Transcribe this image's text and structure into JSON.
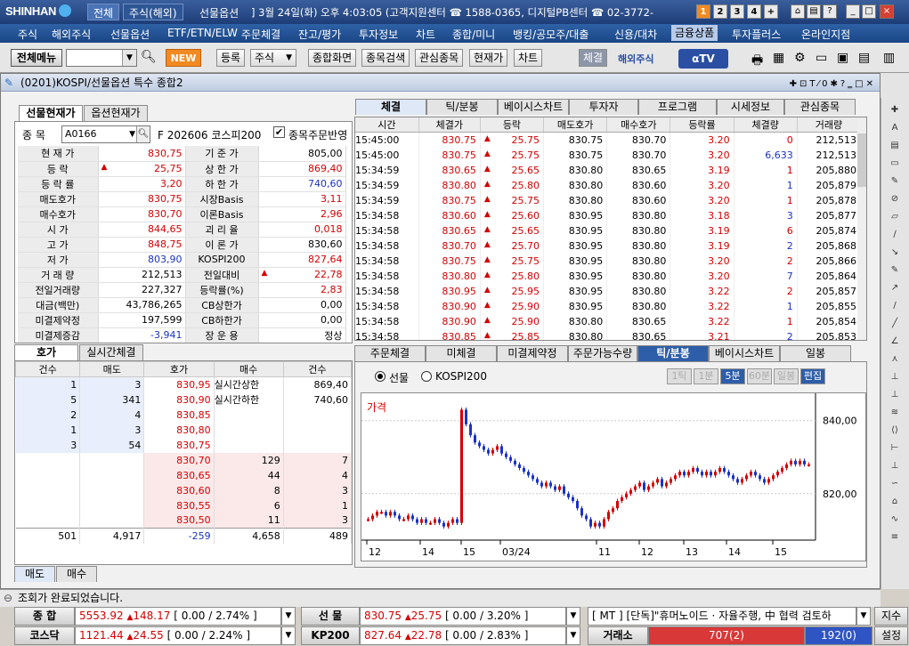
{
  "titlebar": {
    "logo": "SHINHAN",
    "tabs": [
      "전체",
      "주식(해외)",
      "선물옵션"
    ],
    "info": "] 3월 24일(화) 오후 4:03:05 (고객지원센터 ☎ 1588-0365, 디지털PB센터 ☎ 02-3772-",
    "nums": [
      "1",
      "2",
      "3",
      "4",
      "+"
    ]
  },
  "menubar": {
    "items": [
      "주식",
      "해외주식",
      "선물옵션",
      "ETF/ETN/ELW",
      "주문체결",
      "잔고/평가",
      "투자정보",
      "차트",
      "종합/미니",
      "뱅킹/공모주/대출",
      "신용/대차",
      "금융상품",
      "투자플러스",
      "온라인지점"
    ]
  },
  "toolbar": {
    "menu_label": "전체메뉴",
    "new_label": "NEW",
    "buttons": [
      "등록",
      "주식",
      "종합화면",
      "종목검색",
      "관심종목",
      "현재가",
      "차트"
    ],
    "settle_label": "체결",
    "overseas_label": "해외주식",
    "tv_label": "TV"
  },
  "window": {
    "title": "(0201)KOSPI/선물옵션 특수 종합2"
  },
  "left": {
    "tabs": [
      "선물현재가",
      "옵션현재가"
    ],
    "code_label": "종 목",
    "code_value": "A0166",
    "product": "F 202606 코스피200",
    "order_check": "종목주문반영"
  },
  "quote": {
    "rows": [
      {
        "l": "현 재 가",
        "v": "830,75",
        "vc": "red",
        "tri": false,
        "l2": "기 준 가",
        "v2": "805,00",
        "v2c": ""
      },
      {
        "l": "등 락",
        "v": "25,75",
        "vc": "red",
        "tri": true,
        "l2": "상 한 가",
        "v2": "869,40",
        "v2c": "red"
      },
      {
        "l": "등 락 률",
        "v": "3,20",
        "vc": "red",
        "tri": false,
        "l2": "하 한 가",
        "v2": "740,60",
        "v2c": "blue"
      },
      {
        "l": "매도호가",
        "v": "830,75",
        "vc": "red",
        "tri": false,
        "l2": "시장Basis",
        "v2": "3,11",
        "v2c": "red"
      },
      {
        "l": "매수호가",
        "v": "830,70",
        "vc": "red",
        "tri": false,
        "l2": "이론Basis",
        "v2": "2,96",
        "v2c": "red"
      },
      {
        "l": "시 가",
        "v": "844,65",
        "vc": "red",
        "tri": false,
        "l2": "괴 리 율",
        "v2": "0,018",
        "v2c": "red"
      },
      {
        "l": "고 가",
        "v": "848,75",
        "vc": "red",
        "tri": false,
        "l2": "이 론 가",
        "v2": "830,60",
        "v2c": ""
      },
      {
        "l": "저 가",
        "v": "803,90",
        "vc": "blue",
        "tri": false,
        "l2": "KOSPI200",
        "v2": "827,64",
        "v2c": "red"
      },
      {
        "l": "거 래 량",
        "v": "212,513",
        "vc": "",
        "tri": false,
        "l2": "전일대비",
        "v2": "22,78",
        "v2c": "red",
        "tri2": true
      },
      {
        "l": "전일거래량",
        "v": "227,327",
        "vc": "",
        "tri": false,
        "l2": "등락률(%)",
        "v2": "2,83",
        "v2c": "red"
      },
      {
        "l": "대금(백만)",
        "v": "43,786,265",
        "vc": "",
        "tri": false,
        "l2": "CB상한가",
        "v2": "0,00",
        "v2c": ""
      },
      {
        "l": "미결제약정",
        "v": "197,599",
        "vc": "",
        "tri": false,
        "l2": "CB하한가",
        "v2": "0,00",
        "v2c": ""
      },
      {
        "l": "미결제증감",
        "v": "-3,941",
        "vc": "blue",
        "tri": false,
        "l2": "장 운 용",
        "v2": "정상",
        "v2c": ""
      }
    ]
  },
  "trades": {
    "tabs": [
      "체결",
      "틱/분봉",
      "베이시스차트",
      "투자자",
      "프로그램",
      "시세정보",
      "관심종목"
    ],
    "headers": [
      "시간",
      "체결가",
      "등락",
      "매도호가",
      "매수호가",
      "등락률",
      "체결량",
      "거래량"
    ],
    "rows": [
      [
        "15:45:00",
        "830.75",
        "25.75",
        "830.75",
        "830.70",
        "3.20",
        "0",
        "212,513"
      ],
      [
        "15:45:00",
        "830.75",
        "25.75",
        "830.75",
        "830.70",
        "3.20",
        "6,633",
        "212,513"
      ],
      [
        "15:34:59",
        "830.65",
        "25.65",
        "830.80",
        "830.65",
        "3.19",
        "1",
        "205,880"
      ],
      [
        "15:34:59",
        "830.80",
        "25.80",
        "830.80",
        "830.60",
        "3.20",
        "1",
        "205,879"
      ],
      [
        "15:34:59",
        "830.75",
        "25.75",
        "830.80",
        "830.60",
        "3.20",
        "1",
        "205,878"
      ],
      [
        "15:34:58",
        "830.60",
        "25.60",
        "830.95",
        "830.80",
        "3.18",
        "3",
        "205,877"
      ],
      [
        "15:34:58",
        "830.65",
        "25.65",
        "830.95",
        "830.80",
        "3.19",
        "6",
        "205,874"
      ],
      [
        "15:34:58",
        "830.70",
        "25.70",
        "830.95",
        "830.80",
        "3.19",
        "2",
        "205,868"
      ],
      [
        "15:34:58",
        "830.75",
        "25.75",
        "830.95",
        "830.80",
        "3.20",
        "2",
        "205,866"
      ],
      [
        "15:34:58",
        "830.80",
        "25.80",
        "830.95",
        "830.80",
        "3.20",
        "7",
        "205,864"
      ],
      [
        "15:34:58",
        "830.95",
        "25.95",
        "830.95",
        "830.80",
        "3.22",
        "2",
        "205,857"
      ],
      [
        "15:34:58",
        "830.90",
        "25.90",
        "830.95",
        "830.80",
        "3.22",
        "1",
        "205,855"
      ],
      [
        "15:34:58",
        "830.90",
        "25.90",
        "830.80",
        "830.65",
        "3.22",
        "1",
        "205,854"
      ],
      [
        "15:34:58",
        "830.85",
        "25.85",
        "830.80",
        "830.65",
        "3.21",
        "2",
        "205,853"
      ]
    ]
  },
  "orderbook": {
    "tabs": [
      "호가",
      "실시간체결"
    ],
    "headers": [
      "건수",
      "매도",
      "호가",
      "매수",
      "건수"
    ],
    "asks": [
      [
        "1",
        "3",
        "830,95"
      ],
      [
        "5",
        "341",
        "830,90"
      ],
      [
        "2",
        "4",
        "830,85"
      ],
      [
        "1",
        "3",
        "830,80"
      ],
      [
        "3",
        "54",
        "830,75"
      ]
    ],
    "bids": [
      [
        "830,70",
        "129",
        "7"
      ],
      [
        "830,65",
        "44",
        "4"
      ],
      [
        "830,60",
        "8",
        "3"
      ],
      [
        "830,55",
        "6",
        "1"
      ],
      [
        "830,50",
        "11",
        "3"
      ]
    ],
    "info": [
      [
        "실시간상한",
        "869,40"
      ],
      [
        "실시간하한",
        "740,60"
      ]
    ],
    "totals": [
      "501",
      "4,917",
      "-259",
      "4,658",
      "489"
    ],
    "bottom_tabs": [
      "매도",
      "매수"
    ]
  },
  "chartpanel": {
    "tabs": [
      "주문체결",
      "미체결",
      "미결제약정",
      "주문가능수량",
      "틱/분봉",
      "베이시스차트",
      "일봉"
    ],
    "radio": [
      "선물",
      "KOSPI200"
    ],
    "period_buttons": [
      "1틱",
      "1분",
      "5분",
      "60분",
      "일봉",
      "편집"
    ],
    "price_label": "가격"
  },
  "chart_data": {
    "type": "candlestick",
    "ylabel": "가격",
    "y_ticks": [
      "840,00",
      "820,00"
    ],
    "ylim": [
      808,
      847
    ],
    "x_ticks": [
      "12",
      "14",
      "15",
      "03/24",
      "11",
      "12",
      "13",
      "14",
      "15"
    ],
    "series": [
      {
        "values": [
          813,
          814,
          815,
          815,
          814,
          815,
          814,
          813,
          813,
          814,
          813,
          812,
          813,
          812,
          812,
          813,
          812,
          811,
          812,
          813,
          812,
          843,
          839,
          836,
          834,
          833,
          832,
          831,
          832,
          833,
          831,
          830,
          829,
          828,
          827,
          826,
          825,
          824,
          823,
          822,
          823,
          822,
          821,
          822,
          820,
          819,
          818,
          816,
          814,
          813,
          811,
          812,
          811,
          813,
          815,
          816,
          818,
          819,
          820,
          821,
          822,
          823,
          821,
          822,
          823,
          824,
          822,
          823,
          824,
          825,
          826,
          825,
          826,
          827,
          826,
          825,
          826,
          825,
          826,
          827,
          826,
          825,
          824,
          823,
          824,
          825,
          826,
          825,
          824,
          823,
          824,
          825,
          826,
          827,
          828,
          829,
          828,
          829,
          828,
          828
        ]
      }
    ]
  },
  "status": {
    "text": "조회가 완료되었습니다."
  },
  "tickers": [
    {
      "label": "종 합",
      "value": "5553.92",
      "change": "148.17",
      "bracket": "[ 0.00 / 2.74% ]"
    },
    {
      "label": "선 물",
      "value": "830.75",
      "change": "25.75",
      "bracket": "[ 0.00 / 3.20% ]"
    },
    {
      "label": "코스닥",
      "value": "1121.44",
      "change": "24.55",
      "bracket": "[ 0.00 / 2.24% ]"
    },
    {
      "label": "KP200",
      "value": "827.64",
      "change": "22.78",
      "bracket": "[ 0.00 / 2.83% ]"
    }
  ],
  "news": {
    "text": "[ MT ] [단독]\"휴머노이드 · 자율주행, 中 협력 검토하",
    "btn": "지수"
  },
  "exchange": {
    "label": "거래소",
    "up": "707(2)",
    "down": "192(0)",
    "settings": "설정"
  }
}
